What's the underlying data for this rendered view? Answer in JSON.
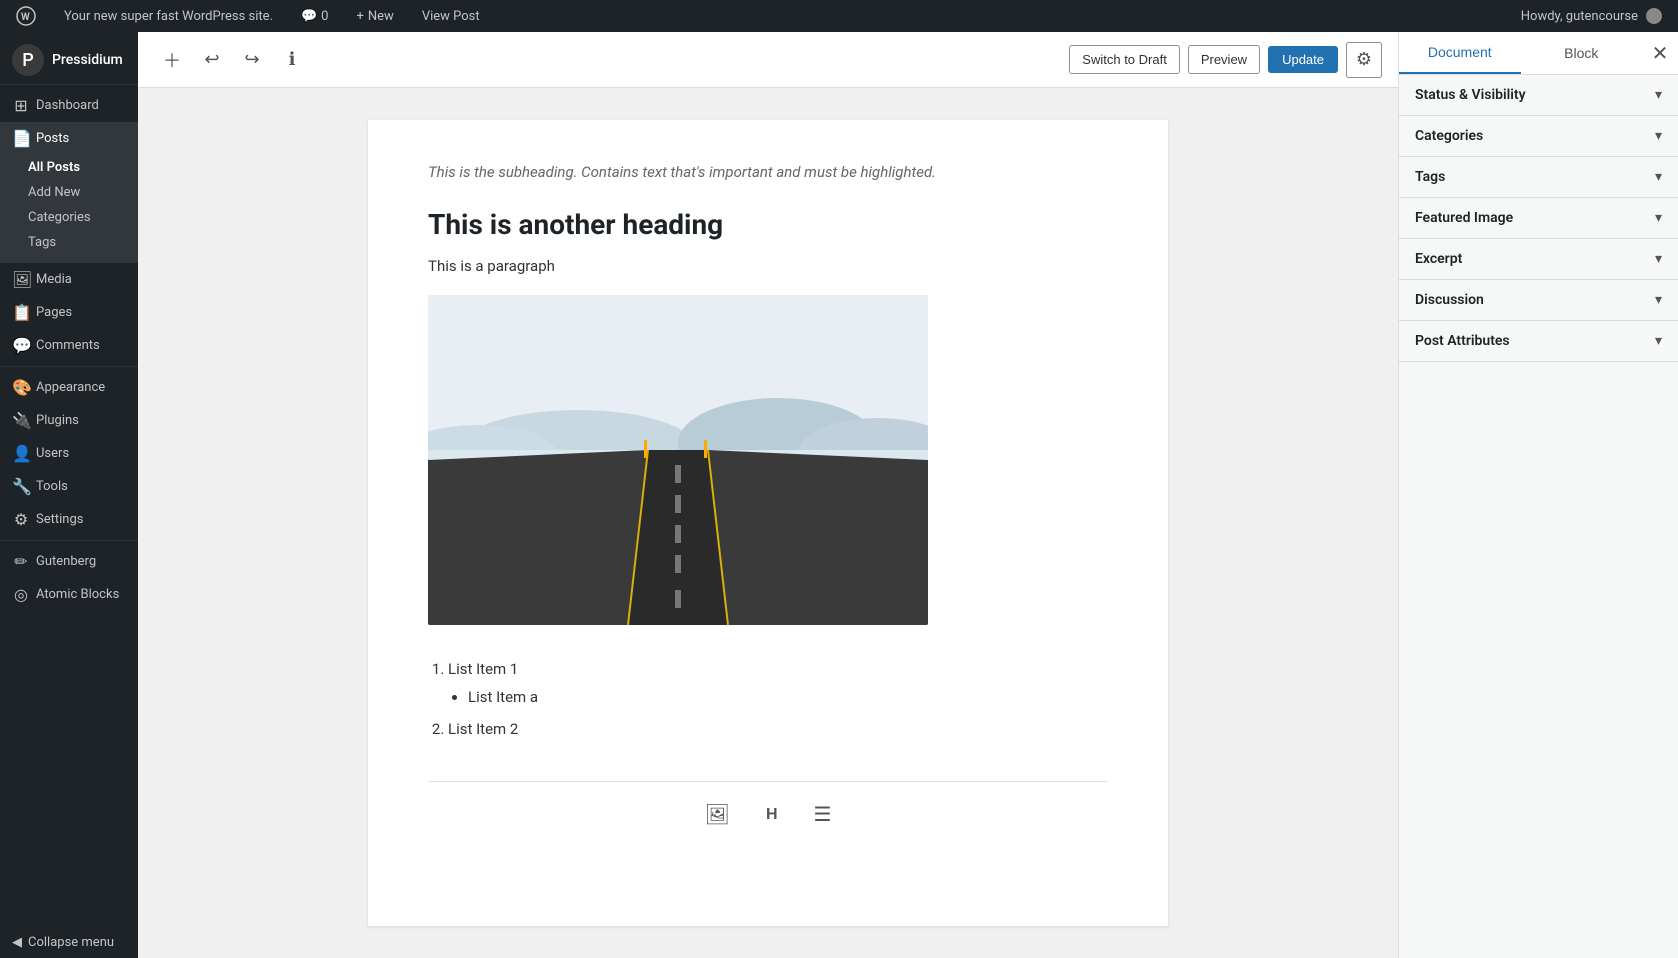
{
  "admin_bar": {
    "site_name": "Your new super fast WordPress site.",
    "comments_count": "0",
    "new_label": "New",
    "view_post_label": "View Post",
    "howdy": "Howdy, gutencourse",
    "wp_icon": "W"
  },
  "sidebar": {
    "brand_name": "Pressidium",
    "items": [
      {
        "id": "dashboard",
        "label": "Dashboard",
        "icon": "⊞"
      },
      {
        "id": "posts",
        "label": "Posts",
        "icon": "📄",
        "active": true
      },
      {
        "id": "media",
        "label": "Media",
        "icon": "🖼"
      },
      {
        "id": "pages",
        "label": "Pages",
        "icon": "📋"
      },
      {
        "id": "comments",
        "label": "Comments",
        "icon": "💬"
      },
      {
        "id": "appearance",
        "label": "Appearance",
        "icon": "🎨"
      },
      {
        "id": "plugins",
        "label": "Plugins",
        "icon": "🔌"
      },
      {
        "id": "users",
        "label": "Users",
        "icon": "👤"
      },
      {
        "id": "tools",
        "label": "Tools",
        "icon": "🔧"
      },
      {
        "id": "settings",
        "label": "Settings",
        "icon": "⚙"
      },
      {
        "id": "gutenberg",
        "label": "Gutenberg",
        "icon": "✏"
      },
      {
        "id": "atomic-blocks",
        "label": "Atomic Blocks",
        "icon": "◎"
      }
    ],
    "posts_submenu": [
      {
        "id": "all-posts",
        "label": "All Posts",
        "active": true
      },
      {
        "id": "add-new",
        "label": "Add New"
      },
      {
        "id": "categories",
        "label": "Categories"
      },
      {
        "id": "tags",
        "label": "Tags"
      }
    ],
    "collapse_label": "Collapse menu"
  },
  "toolbar": {
    "add_block_title": "+",
    "undo_title": "↩",
    "redo_title": "↪",
    "info_title": "ℹ",
    "switch_draft_label": "Switch to Draft",
    "preview_label": "Preview",
    "update_label": "Update",
    "settings_icon": "⚙"
  },
  "content": {
    "subheading": "This is the subheading. Contains text that's important and must be highlighted.",
    "heading": "This is another heading",
    "paragraph": "This is a paragraph",
    "list": [
      {
        "text": "List Item 1",
        "subitems": [
          "List Item a"
        ]
      },
      {
        "text": "List Item 2",
        "subitems": []
      }
    ]
  },
  "right_panel": {
    "tabs": [
      {
        "id": "document",
        "label": "Document",
        "active": true
      },
      {
        "id": "block",
        "label": "Block"
      }
    ],
    "close_icon": "✕",
    "sections": [
      {
        "id": "status-visibility",
        "label": "Status & Visibility"
      },
      {
        "id": "categories",
        "label": "Categories"
      },
      {
        "id": "tags",
        "label": "Tags"
      },
      {
        "id": "featured-image",
        "label": "Featured Image"
      },
      {
        "id": "excerpt",
        "label": "Excerpt"
      },
      {
        "id": "discussion",
        "label": "Discussion"
      },
      {
        "id": "post-attributes",
        "label": "Post Attributes"
      }
    ]
  },
  "block_inserter": {
    "image_icon": "🖼",
    "heading_icon": "H",
    "list_icon": "☰"
  }
}
